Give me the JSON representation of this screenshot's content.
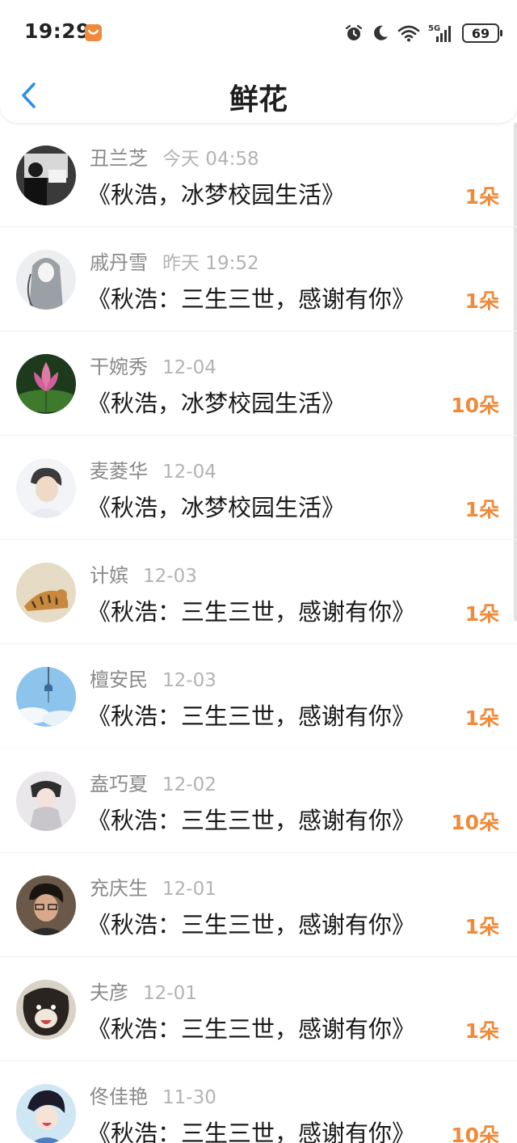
{
  "status_bar": {
    "time": "19:29",
    "battery": "69",
    "network": "5G",
    "icons": [
      "alarm-icon",
      "moon-icon",
      "wifi-icon",
      "signal-icon"
    ]
  },
  "header": {
    "title": "鲜花",
    "back_icon": "chevron-left-icon"
  },
  "colors": {
    "accent": "#f08a3a",
    "back": "#2f8fe6"
  },
  "list": [
    {
      "name": "丑兰芝",
      "time": "今天 04:58",
      "book": "《秋浩，冰梦校园生活》",
      "count": "1朵"
    },
    {
      "name": "戚丹雪",
      "time": "昨天 19:52",
      "book": "《秋浩：三生三世，感谢有你》",
      "count": "1朵"
    },
    {
      "name": "干婉秀",
      "time": "12-04",
      "book": "《秋浩，冰梦校园生活》",
      "count": "10朵"
    },
    {
      "name": "麦菱华",
      "time": "12-04",
      "book": "《秋浩，冰梦校园生活》",
      "count": "1朵"
    },
    {
      "name": "计嫔",
      "time": "12-03",
      "book": "《秋浩：三生三世，感谢有你》",
      "count": "1朵"
    },
    {
      "name": "檀安民",
      "time": "12-03",
      "book": "《秋浩：三生三世，感谢有你》",
      "count": "1朵"
    },
    {
      "name": "盍巧夏",
      "time": "12-02",
      "book": "《秋浩：三生三世，感谢有你》",
      "count": "10朵"
    },
    {
      "name": "充庆生",
      "time": "12-01",
      "book": "《秋浩：三生三世，感谢有你》",
      "count": "1朵"
    },
    {
      "name": "夫彦",
      "time": "12-01",
      "book": "《秋浩：三生三世，感谢有你》",
      "count": "1朵"
    },
    {
      "name": "佟佳艳",
      "time": "11-30",
      "book": "《秋浩：三生三世，感谢有你》",
      "count": "10朵"
    }
  ]
}
